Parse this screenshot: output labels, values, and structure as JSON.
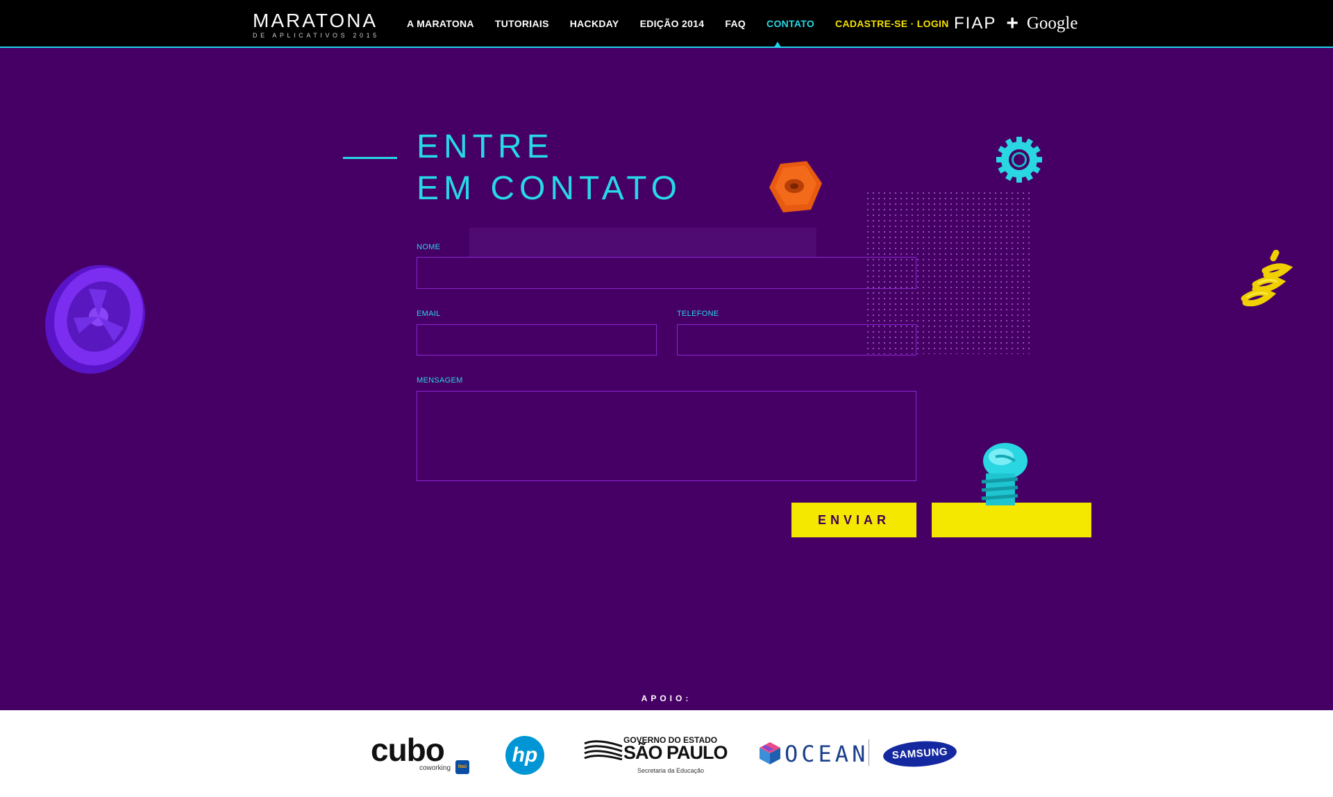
{
  "nav": {
    "logo_title": "MARATONA",
    "logo_subtitle": "DE APLICATIVOS 2015",
    "items": [
      {
        "label": "A MARATONA"
      },
      {
        "label": "TUTORIAIS"
      },
      {
        "label": "HACKDAY"
      },
      {
        "label": "EDIÇÃO 2014"
      },
      {
        "label": "FAQ"
      },
      {
        "label": "CONTATO",
        "active": true
      },
      {
        "label": "CADASTRE-SE · LOGIN"
      }
    ],
    "partner_fiap": "FIAP",
    "partner_plus": "+",
    "partner_google": "Google"
  },
  "page": {
    "heading_line1": "ENTRE",
    "heading_line2": "EM CONTATO"
  },
  "form": {
    "nome_label": "NOME",
    "nome_value": "",
    "email_label": "EMAIL",
    "email_value": "",
    "telefone_label": "TELEFONE",
    "telefone_value": "",
    "mensagem_label": "MENSAGEM",
    "mensagem_value": "",
    "submit_label": "ENVIAR"
  },
  "footer": {
    "apoio_label": "APOIO:",
    "sponsors": {
      "cubo": "cubo",
      "cubo_sub": "coworking",
      "itau": "itaú",
      "hp": "hp",
      "sp_line1": "GOVERNO DO ESTADO",
      "sp_line2": "SÃO PAULO",
      "sp_line3": "Secretaria da Educação",
      "ocean": "OCEAN",
      "samsung": "SAMSUNG"
    }
  },
  "colors": {
    "background": "#460065",
    "accent_cyan": "#27d8e6",
    "accent_yellow": "#f5e800",
    "field_border": "#8a26d6"
  }
}
